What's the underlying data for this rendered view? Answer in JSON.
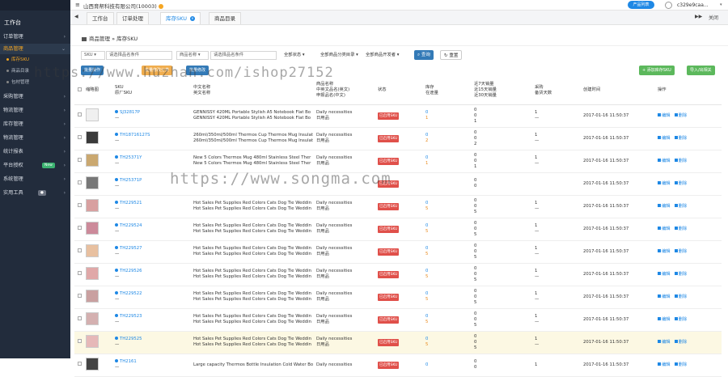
{
  "sidebar": {
    "title": "工作台",
    "menu": [
      {
        "label": "订单管理"
      },
      {
        "label": "商品管理"
      },
      {
        "label": "采购管理"
      },
      {
        "label": "物流管理"
      },
      {
        "label": "库存管理"
      },
      {
        "label": "物流管理"
      },
      {
        "label": "统计报表"
      },
      {
        "label": "平台授权",
        "badge": "New"
      },
      {
        "label": "系统管理"
      },
      {
        "label": "实用工具",
        "badge": "●"
      }
    ],
    "submenu": [
      {
        "label": "库存SKU"
      },
      {
        "label": "商品目录"
      },
      {
        "label": "包材管理"
      }
    ]
  },
  "topbar": {
    "home_icon": "≡",
    "company": "山西育帮科技有限公司(10003)",
    "product_button": "产品列表",
    "user": "c329e9caa...",
    "caret": "▾"
  },
  "tabs": {
    "prev": "◀",
    "next": "▶▶",
    "close_all": "关闭",
    "items": [
      {
        "label": "工作台"
      },
      {
        "label": "订单处理"
      },
      {
        "label": "库存SKU"
      },
      {
        "label": "商品目录"
      }
    ]
  },
  "breadcrumb": {
    "part1": "商品管理",
    "sep": " » ",
    "part2": "库存SKU"
  },
  "filters": {
    "sku_label": "SKU",
    "sku_placeholder": "请选择品名条件",
    "name_label": "商品名称",
    "name_placeholder": "请选择品名条件",
    "status": "全部状态",
    "category": "全部商品分类目录",
    "dev": "全部商品开发者",
    "search": "查询",
    "reset": "重置"
  },
  "toolbar": {
    "b1": "批量操作",
    "b2": "批量修改分类",
    "b3": "批量修改",
    "add": "+ 添加库存SKU",
    "import": "导入/出相关"
  },
  "table": {
    "headers": {
      "img": "缩略图",
      "sku1": "SKU",
      "sku2": "原厂SKU",
      "name1": "中文名称",
      "name2": "英文名称",
      "prop1": "商品名称",
      "prop2": "中英文品名(英文)",
      "prop3": "申报品名(中文)",
      "status": "状态",
      "stock1": "库存",
      "stock2": "在途量",
      "sales1": "近7天销量",
      "sales2": "近15天销量",
      "sales3": "近30天销量",
      "sup1": "采购",
      "sup2": "备货天数",
      "created": "创建时间",
      "actions": "操作"
    },
    "rows": [
      {
        "sku": "SJ32817P",
        "name1": "GENNISSY 420ML Portable Stylish A5 Notebook Flat Bo",
        "name2": "GENNISSY 420ML Portable Stylish A5 Notebook Flat Bo",
        "p1": "Daily necessities",
        "p2": "日用品",
        "status": "已启用SKU",
        "s1": "0",
        "s2": "1",
        "v1": "0",
        "v2": "0",
        "v3": "1",
        "sup": "1",
        "sup2": "—",
        "created": "2017-01-16 11:50:37"
      },
      {
        "sku": "TH18716127S",
        "name1": "260ml/350ml/500ml Thermos Cup Thermos Mug Insulat",
        "name2": "260ml/350ml/500ml Thermos Cup Thermos Mug Insulat",
        "p1": "Daily necessities",
        "p2": "日用品",
        "status": "已启用SKU",
        "s1": "0",
        "s2": "2",
        "v1": "0",
        "v2": "0",
        "v3": "2",
        "sup": "1",
        "sup2": "—",
        "created": "2017-01-16 11:50:37"
      },
      {
        "sku": "TH25371Y",
        "name1": "New 5 Colors Thermos Mug 480ml Stainless Steel Ther",
        "name2": "New 5 Colors Thermos Mug 480ml Stainless Steel Ther",
        "p1": "Daily necessities",
        "p2": "日用品",
        "status": "已启用SKU",
        "s1": "0",
        "s2": "1",
        "v1": "0",
        "v2": "0",
        "v3": "1",
        "sup": "1",
        "sup2": "—",
        "created": "2017-01-16 11:50:37"
      },
      {
        "sku": "TH25371P",
        "name1": "",
        "name2": "",
        "p1": "",
        "p2": "",
        "status": "已启用SKU",
        "s1": "",
        "s2": "",
        "v1": "0",
        "v2": "0",
        "v3": "",
        "sup": "",
        "sup2": "",
        "created": "2017-01-16 11:50:37"
      },
      {
        "sku": "TH229521",
        "name1": "Hot Sales Pet Supplies Red Colors Cats Dog Tie Weddin",
        "name2": "Hot Sales Pet Supplies Red Colors Cats Dog Tie Weddin",
        "p1": "Daily necessities",
        "p2": "日用品",
        "status": "已启用SKU",
        "s1": "0",
        "s2": "5",
        "v1": "0",
        "v2": "0",
        "v3": "5",
        "sup": "1",
        "sup2": "—",
        "created": "2017-01-16 11:50:37"
      },
      {
        "sku": "TH229524",
        "name1": "Hot Sales Pet Supplies Red Colors Cats Dog Tie Weddin",
        "name2": "Hot Sales Pet Supplies Red Colors Cats Dog Tie Weddin",
        "p1": "Daily necessities",
        "p2": "日用品",
        "status": "已启用SKU",
        "s1": "0",
        "s2": "5",
        "v1": "0",
        "v2": "0",
        "v3": "5",
        "sup": "1",
        "sup2": "—",
        "created": "2017-01-16 11:50:37"
      },
      {
        "sku": "TH229527",
        "name1": "Hot Sales Pet Supplies Red Colors Cats Dog Tie Weddin",
        "name2": "Hot Sales Pet Supplies Red Colors Cats Dog Tie Weddin",
        "p1": "Daily necessities",
        "p2": "日用品",
        "status": "已启用SKU",
        "s1": "0",
        "s2": "5",
        "v1": "0",
        "v2": "0",
        "v3": "5",
        "sup": "1",
        "sup2": "—",
        "created": "2017-01-16 11:50:37"
      },
      {
        "sku": "TH229526",
        "name1": "Hot Sales Pet Supplies Red Colors Cats Dog Tie Weddin",
        "name2": "Hot Sales Pet Supplies Red Colors Cats Dog Tie Weddin",
        "p1": "Daily necessities",
        "p2": "日用品",
        "status": "已启用SKU",
        "s1": "0",
        "s2": "5",
        "v1": "0",
        "v2": "0",
        "v3": "5",
        "sup": "1",
        "sup2": "—",
        "created": "2017-01-16 11:50:37"
      },
      {
        "sku": "TH229522",
        "name1": "Hot Sales Pet Supplies Red Colors Cats Dog Tie Weddin",
        "name2": "Hot Sales Pet Supplies Red Colors Cats Dog Tie Weddin",
        "p1": "Daily necessities",
        "p2": "日用品",
        "status": "已启用SKU",
        "s1": "0",
        "s2": "5",
        "v1": "0",
        "v2": "0",
        "v3": "5",
        "sup": "1",
        "sup2": "—",
        "created": "2017-01-16 11:50:37"
      },
      {
        "sku": "TH229523",
        "name1": "Hot Sales Pet Supplies Red Colors Cats Dog Tie Weddin",
        "name2": "Hot Sales Pet Supplies Red Colors Cats Dog Tie Weddin",
        "p1": "Daily necessities",
        "p2": "日用品",
        "status": "已启用SKU",
        "s1": "0",
        "s2": "5",
        "v1": "0",
        "v2": "0",
        "v3": "5",
        "sup": "1",
        "sup2": "—",
        "created": "2017-01-16 11:50:37"
      },
      {
        "sku": "TH229525",
        "name1": "Hot Sales Pet Supplies Red Colors Cats Dog Tie Weddin",
        "name2": "Hot Sales Pet Supplies Red Colors Cats Dog Tie Weddin",
        "p1": "Daily necessities",
        "p2": "日用品",
        "status": "已启用SKU",
        "s1": "0",
        "s2": "5",
        "v1": "0",
        "v2": "0",
        "v3": "5",
        "sup": "1",
        "sup2": "—",
        "created": "2017-01-16 11:50:37"
      },
      {
        "sku": "TH2161",
        "name1": "Large capacity Thermos Bottle Insulation Cold Water Bo",
        "name2": "",
        "p1": "Daily necessities",
        "p2": "",
        "status": "已启用SKU",
        "s1": "0",
        "s2": "",
        "v1": "0",
        "v2": "0",
        "v3": "",
        "sup": "1",
        "sup2": "",
        "created": "2017-01-16 11:50:37"
      }
    ],
    "edit": "编辑",
    "del": "删除"
  },
  "watermarks": {
    "w1": "https://www.huzhan.com/ishop27152",
    "w2": "https://www.songma.com"
  }
}
